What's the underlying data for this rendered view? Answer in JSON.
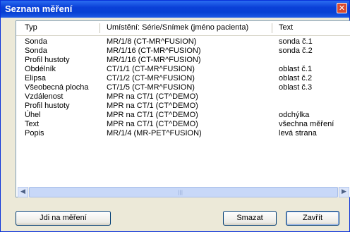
{
  "window": {
    "title": "Seznam měření"
  },
  "columns": [
    "Typ",
    "Umístění: Série/Snímek (jméno pacienta)",
    "Text"
  ],
  "rows": [
    {
      "typ": "Sonda",
      "umisteni": "MR/1/8 (CT-MR^FUSION)",
      "text": "sonda č.1"
    },
    {
      "typ": "Sonda",
      "umisteni": "MR/1/16 (CT-MR^FUSION)",
      "text": "sonda č.2"
    },
    {
      "typ": "Profil hustoty",
      "umisteni": "MR/1/16 (CT-MR^FUSION)",
      "text": ""
    },
    {
      "typ": "Obdélník",
      "umisteni": "CT/1/1 (CT-MR^FUSION)",
      "text": "oblast č.1"
    },
    {
      "typ": "Elipsa",
      "umisteni": "CT/1/2 (CT-MR^FUSION)",
      "text": "oblast č.2"
    },
    {
      "typ": "Všeobecná plocha",
      "umisteni": "CT/1/5 (CT-MR^FUSION)",
      "text": "oblast č.3"
    },
    {
      "typ": "Vzdálenost",
      "umisteni": "MPR na CT/1 (CT^DEMO)",
      "text": ""
    },
    {
      "typ": "Profil hustoty",
      "umisteni": "MPR na CT/1 (CT^DEMO)",
      "text": ""
    },
    {
      "typ": "Úhel",
      "umisteni": "MPR na CT/1 (CT^DEMO)",
      "text": "odchýlka"
    },
    {
      "typ": "Text",
      "umisteni": "MPR na CT/1 (CT^DEMO)",
      "text": "všechna měření"
    },
    {
      "typ": "Popis",
      "umisteni": "MR/1/4 (MR-PET^FUSION)",
      "text": "levá strana"
    }
  ],
  "buttons": {
    "go": "Jdi na měření",
    "delete": "Smazat",
    "close": "Zavřít"
  },
  "icons": {
    "close": "close-icon",
    "scroll_left": "arrow-left-icon",
    "scroll_right": "arrow-right-icon"
  }
}
